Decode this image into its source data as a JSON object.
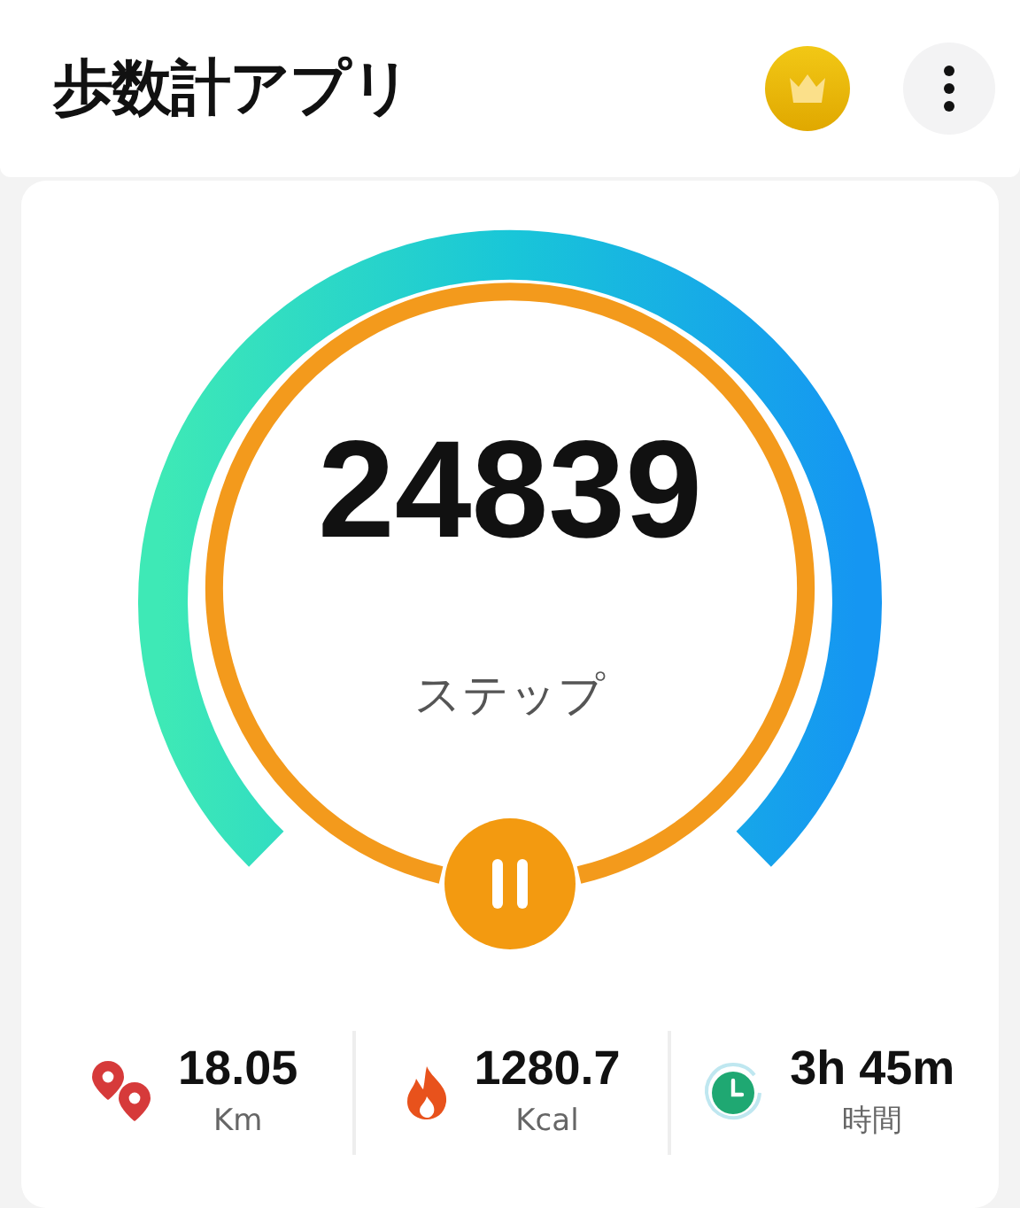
{
  "header": {
    "title": "歩数計アプリ"
  },
  "steps": {
    "count": "24839",
    "label": "ステップ",
    "paused": false
  },
  "stats": [
    {
      "kind": "distance",
      "value": "18.05",
      "unit": "Km"
    },
    {
      "kind": "calories",
      "value": "1280.7",
      "unit": "Kcal"
    },
    {
      "kind": "time",
      "value": "3h 45m",
      "unit": "時間"
    }
  ]
}
